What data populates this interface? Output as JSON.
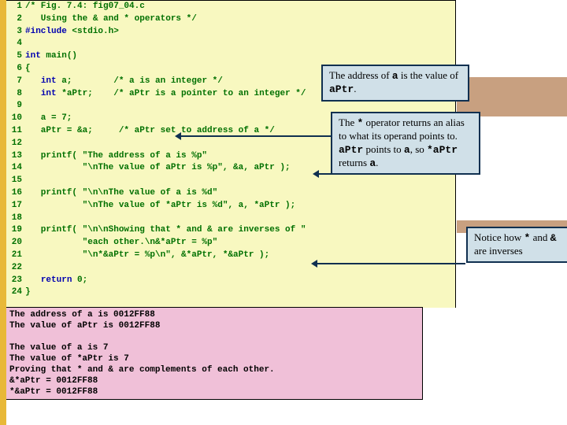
{
  "code": {
    "lines": [
      {
        "n": "1",
        "pre": "/* Fig. 7.4: fig07_04.c",
        "kw": ""
      },
      {
        "n": "2",
        "pre": "   Using the & and * operators */",
        "kw": ""
      },
      {
        "n": "3",
        "pre": "",
        "kw": "#include",
        "post": " <stdio.h>"
      },
      {
        "n": "4",
        "pre": "",
        "kw": ""
      },
      {
        "n": "5",
        "pre": "",
        "kw": "int",
        "post": " main()"
      },
      {
        "n": "6",
        "pre": "{",
        "kw": ""
      },
      {
        "n": "7",
        "pre": "   ",
        "kw": "int",
        "post": " a;        /* a is an integer */"
      },
      {
        "n": "8",
        "pre": "   ",
        "kw": "int",
        "post": " *aPtr;    /* aPtr is a pointer to an integer */"
      },
      {
        "n": "9",
        "pre": "",
        "kw": ""
      },
      {
        "n": "10",
        "pre": "   a = 7;",
        "kw": ""
      },
      {
        "n": "11",
        "pre": "   aPtr = &a;     /* aPtr set to address of a */",
        "kw": ""
      },
      {
        "n": "12",
        "pre": "",
        "kw": ""
      },
      {
        "n": "13",
        "pre": "   printf( \"The address of a is %p\"",
        "kw": ""
      },
      {
        "n": "14",
        "pre": "           \"\\nThe value of aPtr is %p\", &a, aPtr );",
        "kw": ""
      },
      {
        "n": "15",
        "pre": "",
        "kw": ""
      },
      {
        "n": "16",
        "pre": "   printf( \"\\n\\nThe value of a is %d\"",
        "kw": ""
      },
      {
        "n": "17",
        "pre": "           \"\\nThe value of *aPtr is %d\", a, *aPtr );",
        "kw": ""
      },
      {
        "n": "18",
        "pre": "",
        "kw": ""
      },
      {
        "n": "19",
        "pre": "   printf( \"\\n\\nShowing that * and & are inverses of \"",
        "kw": ""
      },
      {
        "n": "20",
        "pre": "           \"each other.\\n&*aPtr = %p\"",
        "kw": ""
      },
      {
        "n": "21",
        "pre": "           \"\\n*&aPtr = %p\\n\", &*aPtr, *&aPtr );",
        "kw": ""
      },
      {
        "n": "22",
        "pre": "",
        "kw": ""
      },
      {
        "n": "23",
        "pre": "   ",
        "kw": "return",
        "post": " 0;"
      },
      {
        "n": "24",
        "pre": "}",
        "kw": ""
      }
    ]
  },
  "output": {
    "l1": "The address of a is 0012FF88",
    "l2": "The value of aPtr is 0012FF88",
    "l3": "",
    "l4": "The value of a is 7",
    "l5": "The value of *aPtr is 7",
    "l6": "Proving that * and & are complements of each other.",
    "l7": "&*aPtr = 0012FF88",
    "l8": "*&aPtr = 0012FF88"
  },
  "callouts": {
    "c1_a": "The address of ",
    "c1_b": "a",
    "c1_c": " is the value of ",
    "c1_d": "aPtr",
    "c1_e": ".",
    "c2_a": "The ",
    "c2_b": "*",
    "c2_c": " operator returns an alias to what its operand points to. ",
    "c2_d": "aPtr",
    "c2_e": " points to ",
    "c2_f": "a",
    "c2_g": ", so ",
    "c2_h": "*aPtr",
    "c2_i": " returns ",
    "c2_j": "a",
    "c2_k": ".",
    "c3_a": "Notice how ",
    "c3_b": "*",
    "c3_c": " and ",
    "c3_d": "&",
    "c3_e": " are inverses"
  }
}
